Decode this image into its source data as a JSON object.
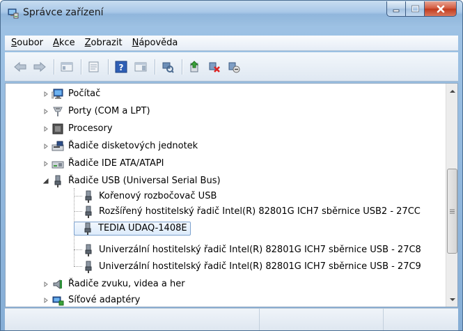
{
  "window": {
    "title": "Správce zařízení"
  },
  "menu": [
    {
      "key": "S",
      "rest": "oubor"
    },
    {
      "key": "A",
      "rest": "kce"
    },
    {
      "key": "Z",
      "rest": "obrazit"
    },
    {
      "key": "N",
      "rest": "ápověda"
    }
  ],
  "toolbar": [
    "back-arrow",
    "forward-arrow",
    "properties",
    "show-hide-console-tree",
    "help",
    "action-pane",
    "scan-hardware",
    "update-driver",
    "uninstall",
    "disable"
  ],
  "tree": {
    "rows": [
      {
        "label": "Počítač",
        "icon": "computer-icon",
        "state": "collapsed"
      },
      {
        "label": "Porty (COM a LPT)",
        "icon": "port-icon",
        "state": "collapsed"
      },
      {
        "label": "Procesory",
        "icon": "processor-icon",
        "state": "collapsed"
      },
      {
        "label": "Řadiče disketových jednotek",
        "icon": "floppy-controller-icon",
        "state": "collapsed"
      },
      {
        "label": "Řadiče IDE ATA/ATAPI",
        "icon": "ide-controller-icon",
        "state": "collapsed"
      },
      {
        "label": "Řadiče USB (Universal Serial Bus)",
        "icon": "usb-icon",
        "state": "expanded"
      },
      {
        "label": "Kořenový rozbočovač USB",
        "icon": "usb-icon",
        "state": "child"
      },
      {
        "label": "Rozšířený hostitelský řadič Intel(R) 82801G ICH7 sběrnice USB2 - 27CC",
        "icon": "usb-icon",
        "state": "child"
      },
      {
        "label": "TEDIA UDAQ-1408E",
        "icon": "usb-icon",
        "state": "child-selected"
      },
      {
        "label": "Univerzální hostitelský řadič Intel(R) 82801G ICH7 sběrnice USB - 27C8",
        "icon": "usb-icon",
        "state": "child"
      },
      {
        "label": "Univerzální hostitelský řadič Intel(R) 82801G ICH7 sběrnice USB - 27C9",
        "icon": "usb-icon",
        "state": "child"
      },
      {
        "label": "Řadiče zvuku, videa a her",
        "icon": "speaker-icon",
        "state": "collapsed"
      },
      {
        "label": "Síťové adaptéry",
        "icon": "network-adapter-icon",
        "state": "collapsed"
      }
    ]
  },
  "colors": {
    "selection_border": "#7da2ce",
    "selection_fill": "#dcebfb"
  }
}
